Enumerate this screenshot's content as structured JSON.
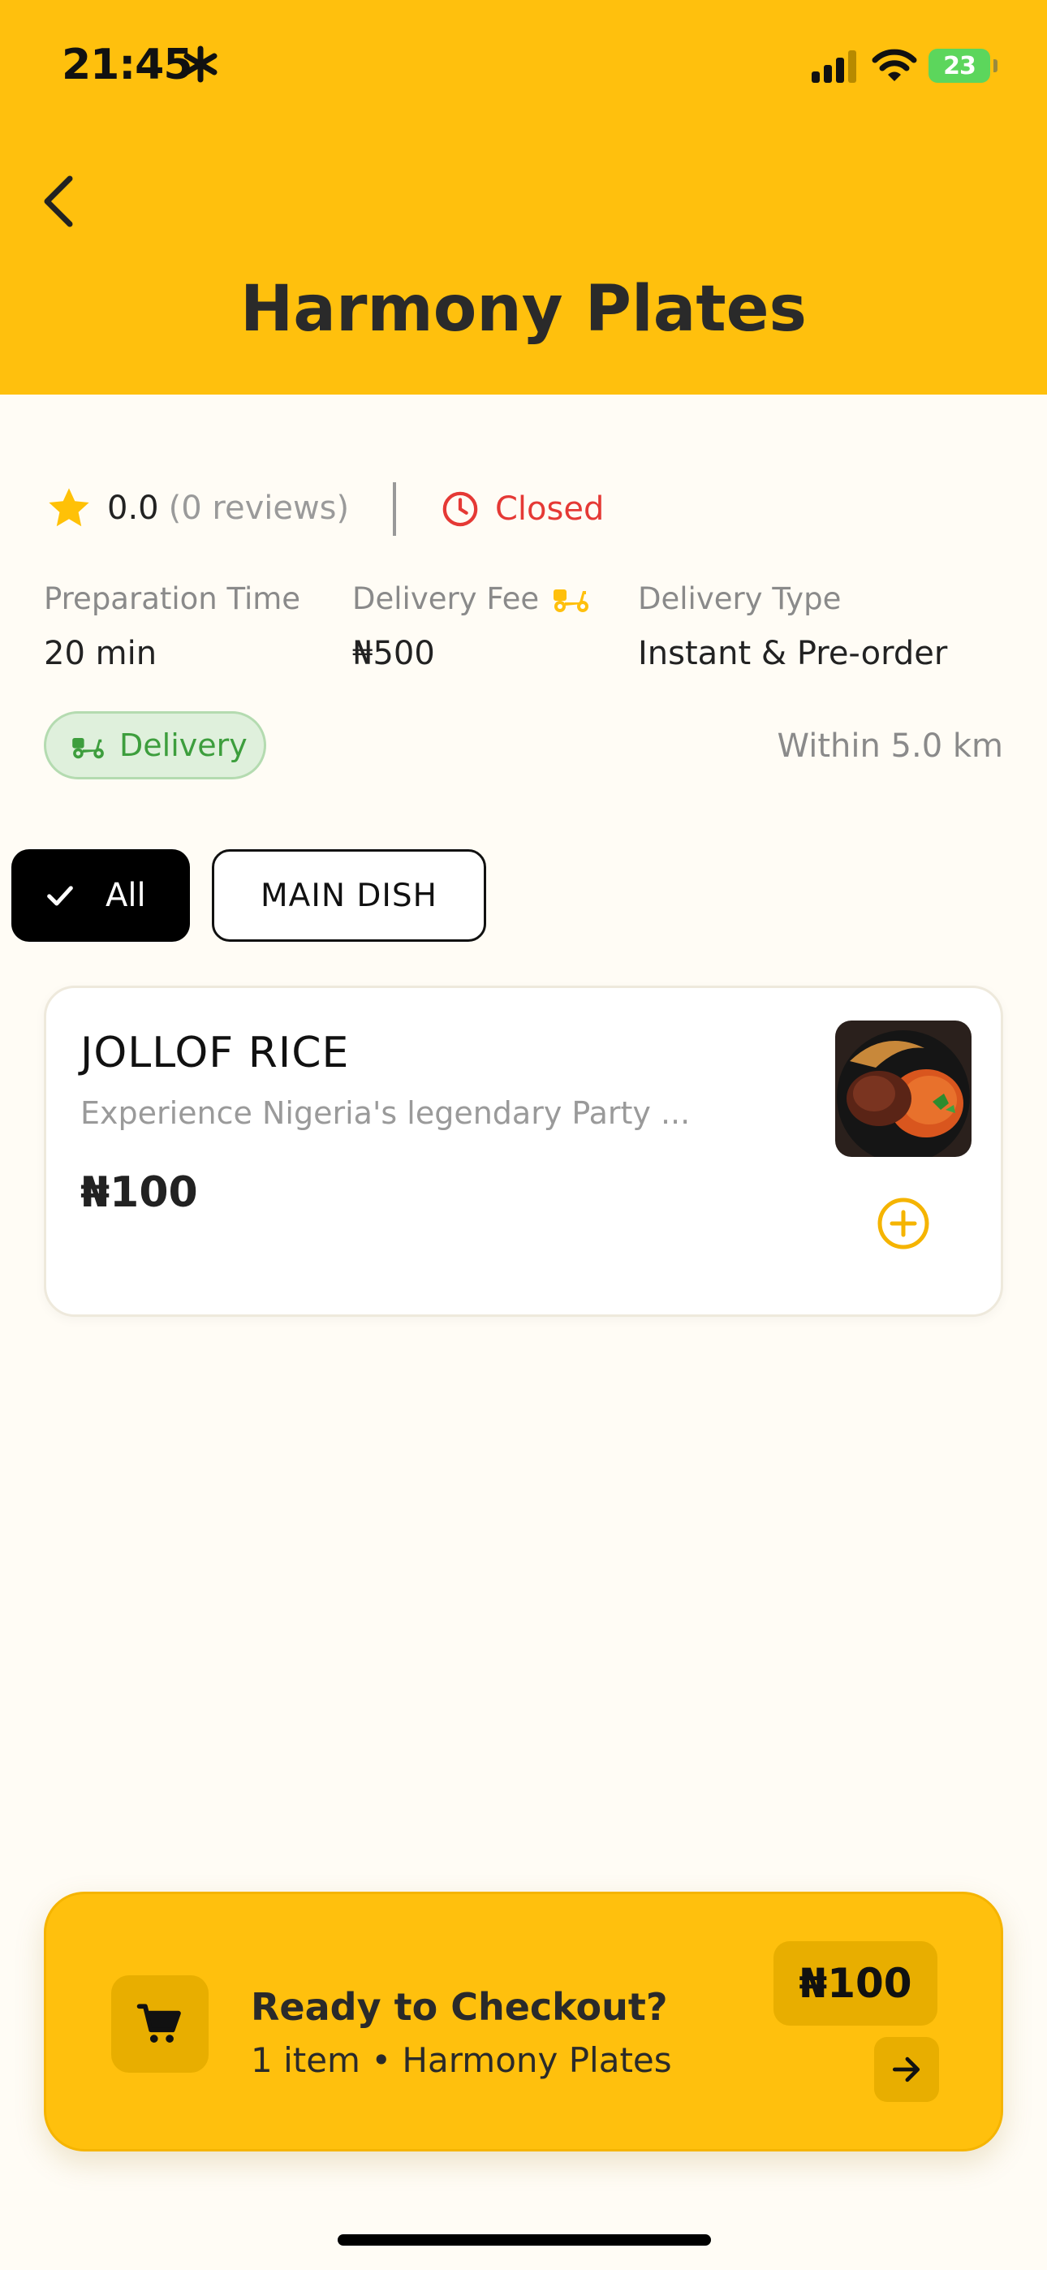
{
  "status_bar": {
    "time": "21:45",
    "battery": "23"
  },
  "header": {
    "title": "Harmony Plates"
  },
  "restaurant": {
    "rating": "0.0",
    "reviews": "(0 reviews)",
    "status": "Closed",
    "preparation_time_label": "Preparation Time",
    "preparation_time": "20 min",
    "delivery_fee_label": "Delivery Fee",
    "delivery_fee": "₦500",
    "delivery_type_label": "Delivery Type",
    "delivery_type": "Instant & Pre-order",
    "delivery_chip": "Delivery",
    "delivery_radius": "Within 5.0 km"
  },
  "filters": {
    "all": "All",
    "main_dish": "MAIN DISH"
  },
  "dish": {
    "name": "JOLLOF RICE",
    "description": "Experience Nigeria's legendary Party ...",
    "price": "₦100"
  },
  "checkout": {
    "title": "Ready to Checkout?",
    "subtitle": "1 item • Harmony Plates",
    "total": "₦100"
  },
  "colors": {
    "brand_yellow": "#FFC00D",
    "closed_red": "#E53935",
    "delivery_green": "#3D9E3D"
  }
}
